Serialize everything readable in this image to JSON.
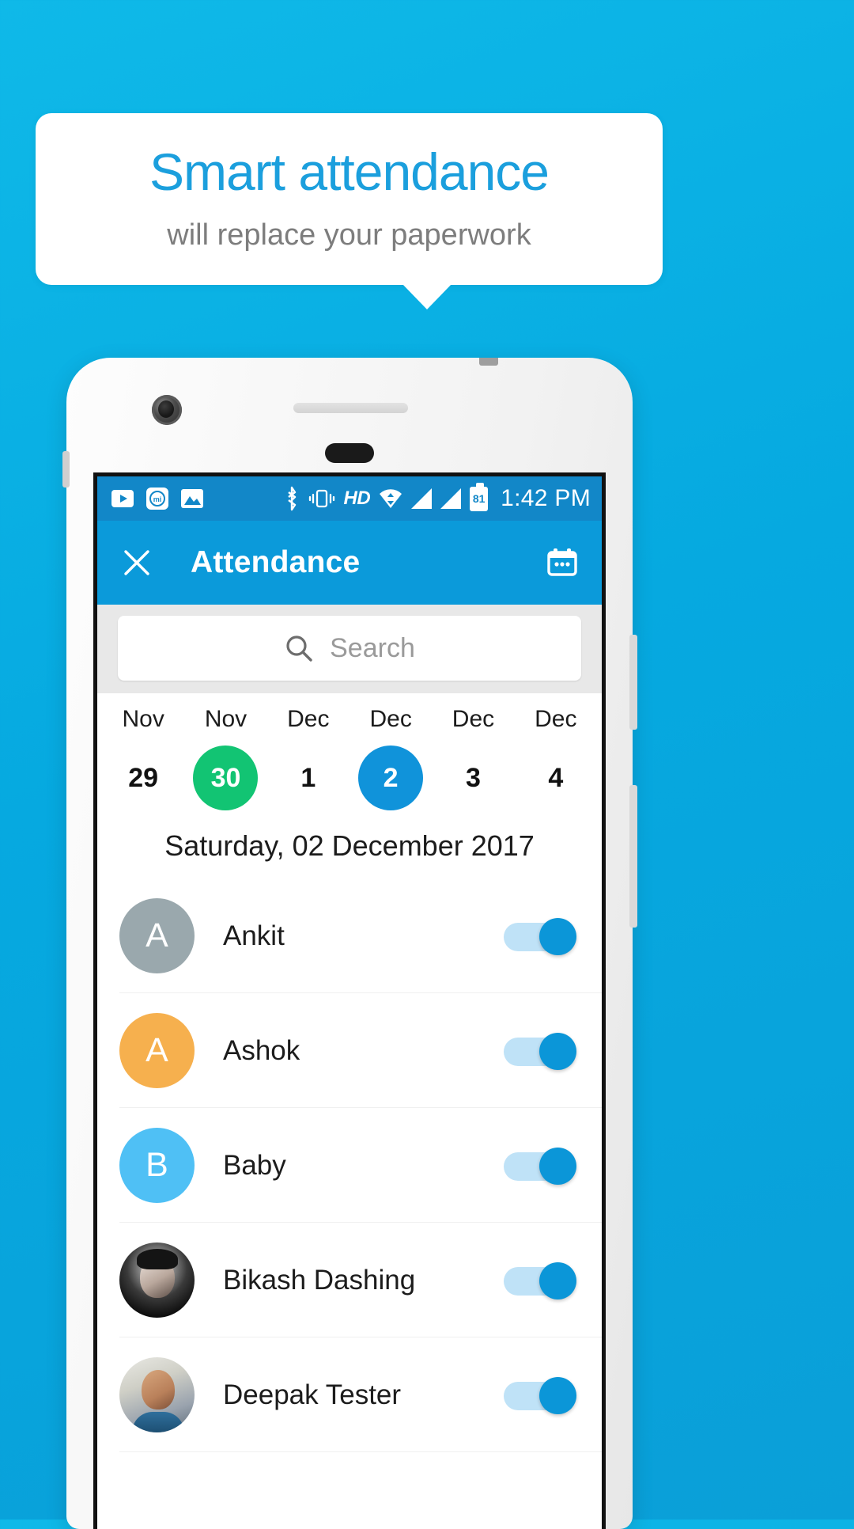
{
  "promo": {
    "headline": "Smart attendance",
    "subhead": "will replace your paperwork",
    "headline_color": "#1b9fdd",
    "subhead_color": "#7d7d7d",
    "background_color": "#06a9e0"
  },
  "statusbar": {
    "left_icons": [
      "youtube-icon",
      "mi-browser-icon",
      "gallery-icon"
    ],
    "right_icons": [
      "bluetooth-icon",
      "vibrate-icon",
      "hd-icon",
      "wifi-icon",
      "signal-icon",
      "signal-icon",
      "battery-icon"
    ],
    "hd_label": "HD",
    "battery_level": "81",
    "time": "1:42 PM",
    "bg_color": "#1287c8"
  },
  "appbar": {
    "close_icon": "close-icon",
    "title": "Attendance",
    "calendar_icon": "calendar-icon",
    "bg_color": "#0b9ada"
  },
  "search": {
    "icon": "search-icon",
    "placeholder": "Search",
    "value": ""
  },
  "datestrip": [
    {
      "month": "Nov",
      "day": "29",
      "state": "normal"
    },
    {
      "month": "Nov",
      "day": "30",
      "state": "today"
    },
    {
      "month": "Dec",
      "day": "1",
      "state": "normal"
    },
    {
      "month": "Dec",
      "day": "2",
      "state": "selected"
    },
    {
      "month": "Dec",
      "day": "3",
      "state": "normal"
    },
    {
      "month": "Dec",
      "day": "4",
      "state": "normal"
    }
  ],
  "date_header": "Saturday, 02 December 2017",
  "colors": {
    "today": "#12c473",
    "selected": "#1093da",
    "toggle_track": "#bfe2f7",
    "toggle_thumb": "#0b96d8"
  },
  "attendees": [
    {
      "name": "Ankit",
      "initial": "A",
      "avatar_type": "initial",
      "avatar_color": "#9aa8ad",
      "toggle": "on"
    },
    {
      "name": "Ashok",
      "initial": "A",
      "avatar_type": "initial",
      "avatar_color": "#f6b04e",
      "toggle": "on"
    },
    {
      "name": "Baby",
      "initial": "B",
      "avatar_type": "initial",
      "avatar_color": "#4fc0f5",
      "toggle": "on"
    },
    {
      "name": "Bikash Dashing",
      "initial": "",
      "avatar_type": "photo-1",
      "avatar_color": "#1a1a1a",
      "toggle": "on"
    },
    {
      "name": "Deepak Tester",
      "initial": "",
      "avatar_type": "photo-2",
      "avatar_color": "#b8b8b0",
      "toggle": "on"
    }
  ]
}
